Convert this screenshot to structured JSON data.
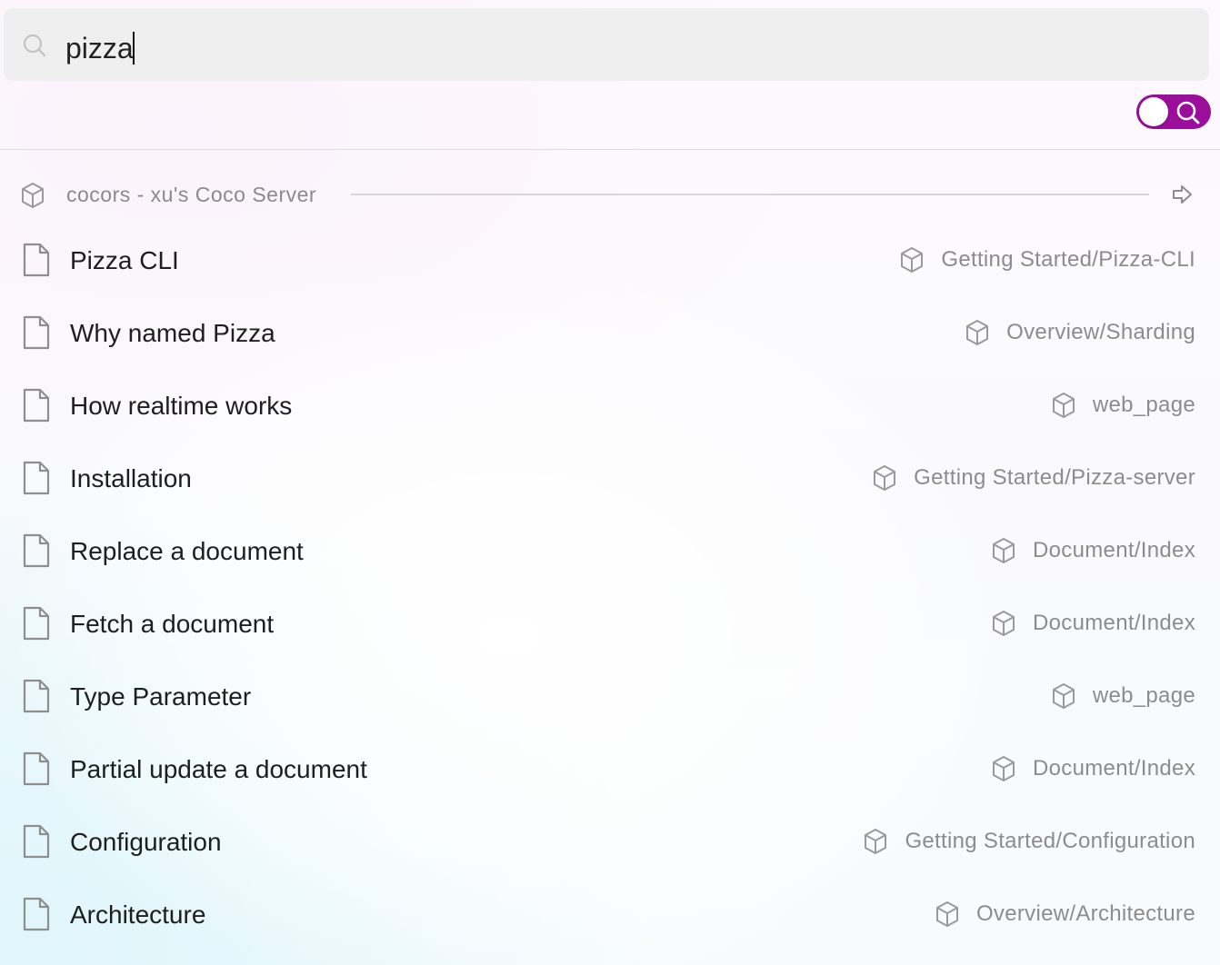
{
  "search": {
    "value": "pizza",
    "placeholder": ""
  },
  "colors": {
    "toggle_accent": "#9b0e9b",
    "muted_text": "#8a8a8a"
  },
  "icons": {
    "search": "search-icon",
    "group": "cube-icon",
    "go": "arrow-right-icon",
    "document": "document-icon",
    "source": "cube-icon"
  },
  "group": {
    "title": "cocors - xu's Coco Server"
  },
  "results": [
    {
      "title": "Pizza CLI",
      "source": "Getting Started/Pizza-CLI"
    },
    {
      "title": "Why named Pizza",
      "source": "Overview/Sharding"
    },
    {
      "title": "How realtime works",
      "source": "web_page"
    },
    {
      "title": "Installation",
      "source": "Getting Started/Pizza-server"
    },
    {
      "title": "Replace a document",
      "source": "Document/Index"
    },
    {
      "title": "Fetch a document",
      "source": "Document/Index"
    },
    {
      "title": "Type Parameter",
      "source": "web_page"
    },
    {
      "title": "Partial update a document",
      "source": "Document/Index"
    },
    {
      "title": "Configuration",
      "source": "Getting Started/Configuration"
    },
    {
      "title": "Architecture",
      "source": "Overview/Architecture"
    }
  ]
}
